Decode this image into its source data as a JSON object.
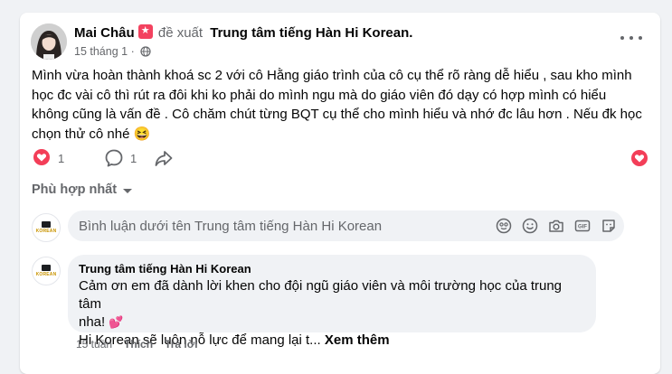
{
  "post": {
    "author": "Mai Châu",
    "suggest_text": "đề xuất",
    "page_name": "Trung tâm tiếng Hàn Hi Korean",
    "page_suffix": ".",
    "time": "15 tháng 1",
    "time_sep": "·",
    "text": "Mình vừa hoàn thành khoá sc 2 với cô Hằng giáo trình của cô cụ thể rõ ràng dễ hiểu , sau kho mình học đc vài cô thì rút ra đôi khi ko phải do mình ngu mà do giáo viên đó dạy có hợp mình có hiểu không cũng là vấn đề . Cô chăm chút từng BQT cụ thể cho mình hiểu và nhớ đc lâu hơn . Nếu đk học chọn thử cô nhé 😆",
    "like_count": "1",
    "comment_count": "1",
    "colors": {
      "love": "#f33e58",
      "badge": "#f3425f"
    }
  },
  "sort": {
    "label": "Phù hợp nhất"
  },
  "composer": {
    "placeholder": "Bình luận dưới tên Trung tâm tiếng Hàn Hi Korean",
    "icons": [
      "avatar-sticker-icon",
      "emoji-icon",
      "camera-icon",
      "gif-icon",
      "sticker-icon"
    ]
  },
  "logo": {
    "text": "KOREAN"
  },
  "comment": {
    "author": "Trung tâm tiếng Hàn Hi Korean",
    "line1": "Cảm ơn em đã dành lời khen cho đội ngũ giáo viên và môi trường học của trung tâm",
    "line2": "nha!",
    "heart": "💕",
    "line3": "Hi Korean sẽ luôn nỗ lực để mang lại t...",
    "see_more": "Xem thêm",
    "time": "15 tuần",
    "like": "Thích",
    "reply": "Trả lời"
  }
}
